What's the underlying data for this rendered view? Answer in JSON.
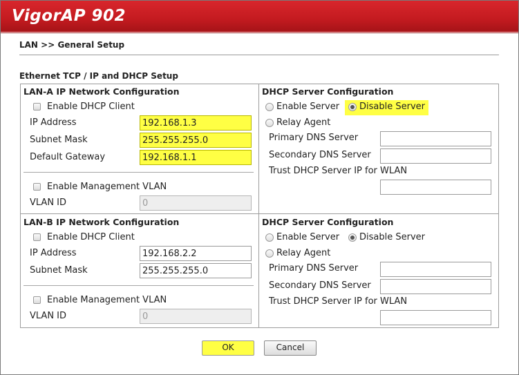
{
  "header": {
    "logo": "VigorAP 902"
  },
  "breadcrumb": "LAN >> General Setup",
  "section_title": "Ethernet TCP / IP and DHCP Setup",
  "lanA": {
    "title": "LAN-A IP Network Configuration",
    "enable_dhcp_client": "Enable DHCP Client",
    "ip_label": "IP Address",
    "ip_value": "192.168.1.3",
    "mask_label": "Subnet Mask",
    "mask_value": "255.255.255.0",
    "gateway_label": "Default Gateway",
    "gateway_value": "192.168.1.1",
    "enable_vlan": "Enable Management VLAN",
    "vlan_label": "VLAN ID",
    "vlan_value": "0"
  },
  "dhcpA": {
    "title": "DHCP Server Configuration",
    "enable_server": "Enable Server",
    "disable_server": "Disable Server",
    "relay_agent": "Relay Agent",
    "primary_dns": "Primary DNS Server",
    "secondary_dns": "Secondary DNS Server",
    "trust_ip": "Trust DHCP Server IP for WLAN"
  },
  "lanB": {
    "title": "LAN-B IP Network Configuration",
    "enable_dhcp_client": "Enable DHCP Client",
    "ip_label": "IP Address",
    "ip_value": "192.168.2.2",
    "mask_label": "Subnet Mask",
    "mask_value": "255.255.255.0",
    "enable_vlan": "Enable Management VLAN",
    "vlan_label": "VLAN ID",
    "vlan_value": "0"
  },
  "dhcpB": {
    "title": "DHCP Server Configuration",
    "enable_server": "Enable Server",
    "disable_server": "Disable Server",
    "relay_agent": "Relay Agent",
    "primary_dns": "Primary DNS Server",
    "secondary_dns": "Secondary DNS Server",
    "trust_ip": "Trust DHCP Server IP for WLAN"
  },
  "buttons": {
    "ok": "OK",
    "cancel": "Cancel"
  },
  "colors": {
    "header_red": "#c41b20",
    "highlight": "#ffff44"
  }
}
